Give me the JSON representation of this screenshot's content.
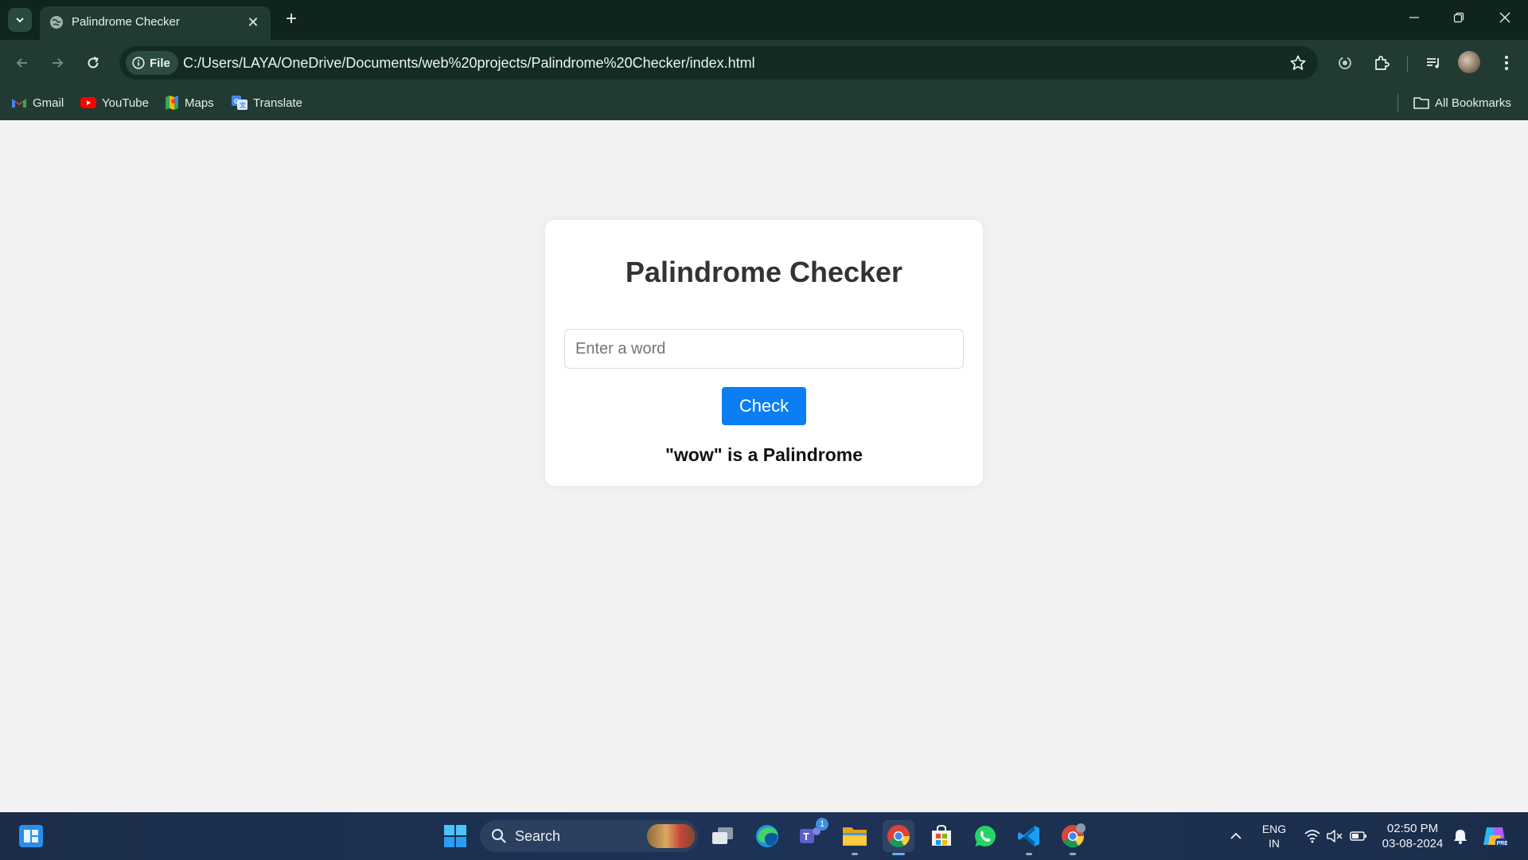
{
  "browser": {
    "tab": {
      "title": "Palindrome Checker"
    },
    "address_bar": {
      "scheme_chip": "File",
      "url": "C:/Users/LAYA/OneDrive/Documents/web%20projects/Palindrome%20Checker/index.html"
    },
    "bookmarks": [
      {
        "label": "Gmail",
        "icon": "gmail-icon"
      },
      {
        "label": "YouTube",
        "icon": "youtube-icon"
      },
      {
        "label": "Maps",
        "icon": "maps-icon"
      },
      {
        "label": "Translate",
        "icon": "translate-icon"
      }
    ],
    "all_bookmarks_label": "All Bookmarks"
  },
  "page": {
    "title": "Palindrome Checker",
    "input": {
      "placeholder": "Enter a word",
      "value": ""
    },
    "button_label": "Check",
    "result": "\"wow\" is a Palindrome"
  },
  "taskbar": {
    "search_label": "Search",
    "pinned_apps": [
      "task-view",
      "edge",
      "teams",
      "file-explorer",
      "chrome",
      "microsoft-store",
      "whatsapp",
      "vscode",
      "chrome-profile"
    ],
    "teams_badge": "1",
    "language": {
      "line1": "ENG",
      "line2": "IN"
    },
    "clock": {
      "time": "02:50 PM",
      "date": "03-08-2024"
    }
  },
  "colors": {
    "chrome_bg": "#213b32",
    "tabstrip_bg": "#10241e",
    "page_bg": "#f2f2f2",
    "button_blue": "#0a7ef2",
    "taskbar_bg": "#1d3257"
  }
}
